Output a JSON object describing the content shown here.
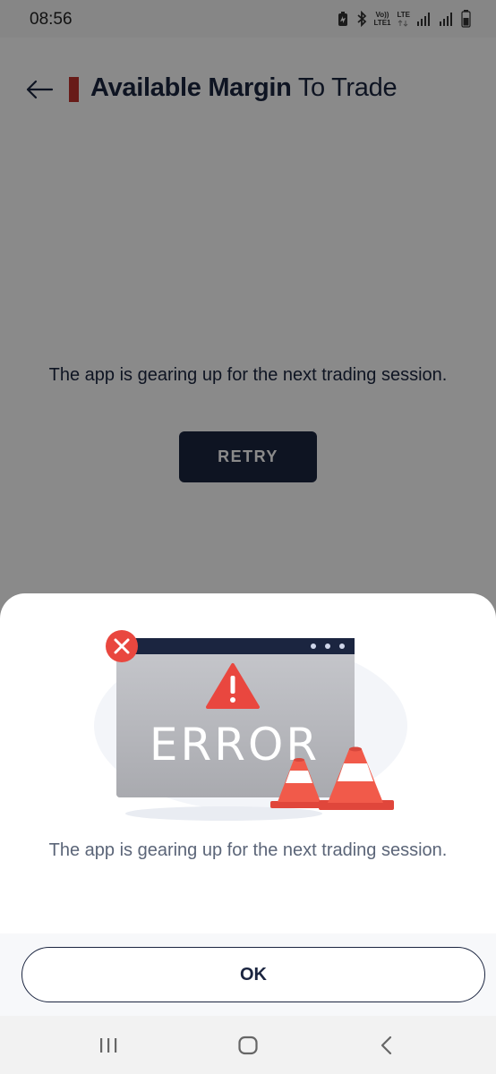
{
  "status_bar": {
    "time": "08:56",
    "volte_label": "Vo))",
    "lte1_label": "LTE1",
    "lte_label": "LTE"
  },
  "header": {
    "title_bold": "Available Margin",
    "title_light": " To Trade",
    "accent_color": "#c0332e"
  },
  "main": {
    "message": "The app is gearing up for the next trading session.",
    "retry_label": "RETRY"
  },
  "error_sheet": {
    "illustration_text": "ERROR",
    "message": "The app is gearing up for the next trading session.",
    "ok_label": "OK"
  },
  "colors": {
    "primary": "#1b2540",
    "error_red": "#e9473f",
    "cone_orange": "#f15a4a"
  },
  "nav_bar": {
    "items": [
      "recents-icon",
      "home-icon",
      "back-icon"
    ]
  }
}
